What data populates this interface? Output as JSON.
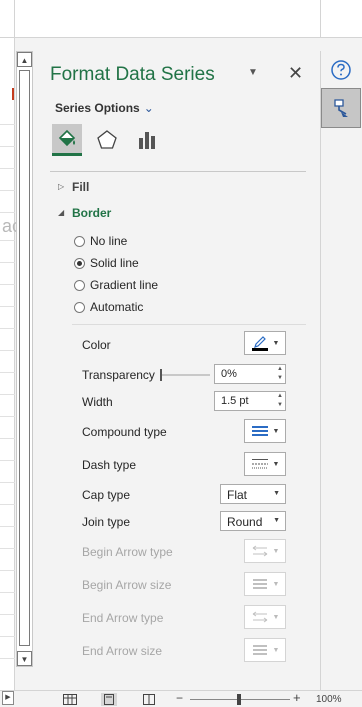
{
  "pane": {
    "title": "Format Data Series",
    "series_options_label": "Series Options",
    "tabs": [
      {
        "name": "fill-and-line",
        "active": true
      },
      {
        "name": "effects",
        "active": false
      },
      {
        "name": "series-options",
        "active": false
      }
    ],
    "sections": {
      "fill": "Fill",
      "border": "Border"
    },
    "border_options": [
      {
        "label": "No line",
        "selected": false
      },
      {
        "label": "Solid line",
        "selected": true
      },
      {
        "label": "Gradient line",
        "selected": false
      },
      {
        "label": "Automatic",
        "selected": false
      }
    ],
    "properties": {
      "color": "Color",
      "transparency": "Transparency",
      "transparency_value": "0%",
      "width": "Width",
      "width_value": "1.5 pt",
      "compound_type": "Compound type",
      "dash_type": "Dash type",
      "cap_type": "Cap type",
      "cap_value": "Flat",
      "join_type": "Join type",
      "join_value": "Round",
      "begin_arrow_type": "Begin Arrow type",
      "begin_arrow_size": "Begin Arrow size",
      "end_arrow_type": "End Arrow type",
      "end_arrow_size": "End Arrow size"
    },
    "transparency_level": 0
  },
  "status": {
    "zoom": "100%"
  },
  "colors": {
    "accent": "#217346",
    "line_color": "#000000",
    "compound_blue": "#2b6cc4"
  }
}
